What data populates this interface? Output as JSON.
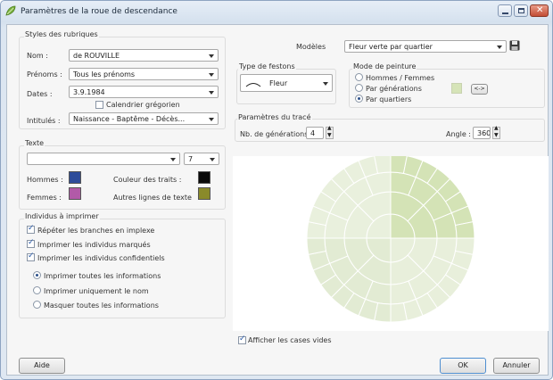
{
  "window": {
    "title": "Paramètres de la roue de descendance"
  },
  "styles": {
    "group_title": "Styles des rubriques",
    "nom_label": "Nom :",
    "nom_value": "de ROUVILLE",
    "prenoms_label": "Prénoms :",
    "prenoms_value": "Tous les prénoms",
    "dates_label": "Dates :",
    "dates_value": "3.9.1984",
    "calendar_label": "Calendrier grégorien",
    "calendar_checked": false,
    "intitules_label": "Intitulés :",
    "intitules_value": "Naissance - Baptême - Décès..."
  },
  "texte": {
    "group_title": "Texte",
    "font_value": "",
    "size_value": "7",
    "hommes_label": "Hommes :",
    "hommes_color": "#2e4c9a",
    "femmes_label": "Femmes :",
    "femmes_color": "#b25aa8",
    "traits_label": "Couleur des traits :",
    "traits_color": "#0a0a0a",
    "autres_label": "Autres lignes de texte",
    "autres_color": "#8a8a2a"
  },
  "individus": {
    "group_title": "Individus à imprimer",
    "checks": [
      {
        "label": "Répéter les branches en implexe",
        "checked": true
      },
      {
        "label": "Imprimer les individus marqués",
        "checked": true
      },
      {
        "label": "Imprimer les individus confidentiels",
        "checked": true
      }
    ],
    "radios": [
      {
        "label": "Imprimer toutes les informations",
        "selected": true
      },
      {
        "label": "Imprimer uniquement le nom",
        "selected": false
      },
      {
        "label": "Masquer toutes les informations",
        "selected": false
      }
    ]
  },
  "modeles": {
    "label": "Modèles",
    "value": "Fleur verte par quartier"
  },
  "festons": {
    "group_title": "Type de festons",
    "value": "Fleur"
  },
  "peinture": {
    "group_title": "Mode de peinture",
    "options": [
      {
        "label": "Hommes / Femmes",
        "selected": false
      },
      {
        "label": "Par générations",
        "selected": false
      },
      {
        "label": "Par quartiers",
        "selected": true
      }
    ],
    "swatch_color": "#d6e4b8",
    "swap_label": "<->"
  },
  "trace": {
    "group_title": "Paramètres du tracé",
    "generations_label": "Nb. de générations :",
    "generations_value": "4",
    "angle_label": "Angle :",
    "angle_value": "360"
  },
  "preview": {
    "show_empty_label": "Afficher les cases vides",
    "show_empty_checked": true
  },
  "footer": {
    "aide_label": "Aide",
    "ok_label": "OK",
    "annuler_label": "Annuler"
  }
}
